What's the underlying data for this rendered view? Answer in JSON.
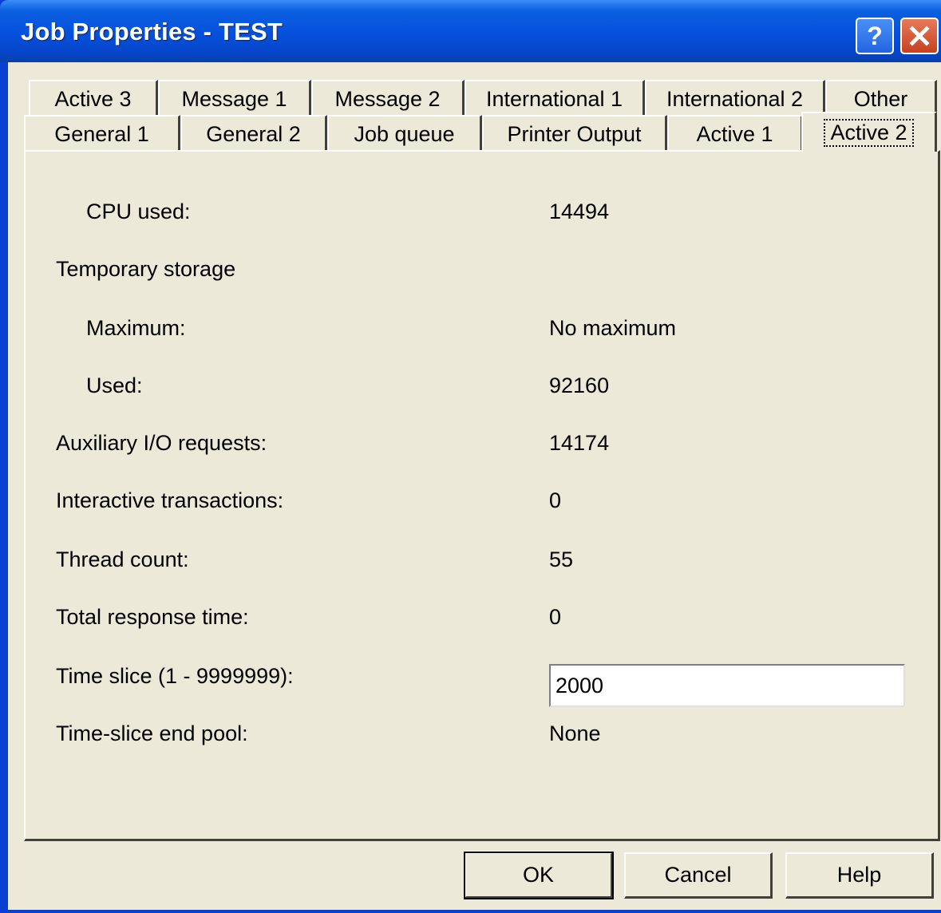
{
  "window": {
    "title": "Job Properties - TEST",
    "help_glyph": "?",
    "accent": "#0650dc"
  },
  "tabs": {
    "row1": [
      {
        "label": "Active 3"
      },
      {
        "label": "Message 1"
      },
      {
        "label": "Message 2"
      },
      {
        "label": "International 1"
      },
      {
        "label": "International 2"
      },
      {
        "label": "Other"
      }
    ],
    "row2": [
      {
        "label": "General 1"
      },
      {
        "label": "General 2"
      },
      {
        "label": "Job queue"
      },
      {
        "label": "Printer Output"
      },
      {
        "label": "Active 1"
      },
      {
        "label": "Active 2",
        "selected": true
      }
    ]
  },
  "fields": {
    "cpu_used": {
      "label": "CPU used:",
      "value": "14494"
    },
    "temporary_storage": {
      "label": "Temporary storage"
    },
    "maximum": {
      "label": "Maximum:",
      "value": "No maximum"
    },
    "used": {
      "label": "Used:",
      "value": "92160"
    },
    "aux_io": {
      "label": "Auxiliary I/O requests:",
      "value": "14174"
    },
    "interactive": {
      "label": "Interactive transactions:",
      "value": "0"
    },
    "thread_count": {
      "label": "Thread count:",
      "value": "55"
    },
    "total_response": {
      "label": "Total response time:",
      "value": "0"
    },
    "time_slice": {
      "label": "Time slice  (1 - 9999999):",
      "value": "2000"
    },
    "time_slice_end_pool": {
      "label": "Time-slice end pool:",
      "value": "None"
    }
  },
  "buttons": {
    "ok": "OK",
    "cancel": "Cancel",
    "help": "Help"
  }
}
